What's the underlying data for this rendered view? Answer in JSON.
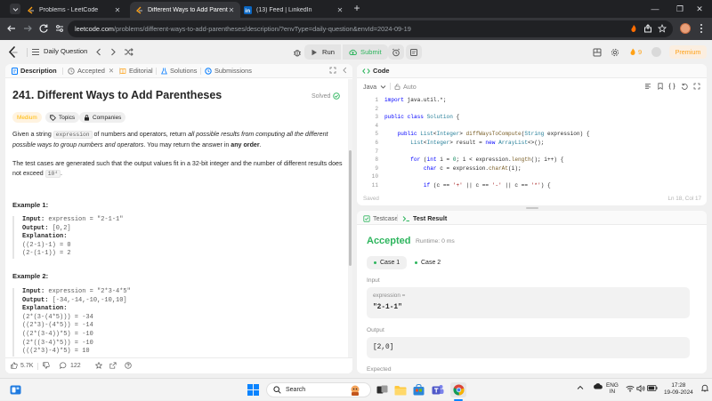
{
  "browser": {
    "tabs": [
      {
        "title": "Problems - LeetCode",
        "icon": "leetcode-icon",
        "active": false
      },
      {
        "title": "Different Ways to Add Parenthe",
        "icon": "leetcode-icon",
        "active": true
      },
      {
        "title": "(13) Feed | LinkedIn",
        "icon": "linkedin-icon",
        "active": false
      }
    ],
    "url_host": "leetcode.com",
    "url_path": "/problems/different-ways-to-add-parentheses/description/?envType=daily-question&envId=2024-09-19"
  },
  "header": {
    "daily_label": "Daily Question",
    "run_label": "Run",
    "submit_label": "Submit",
    "streak_count": "9",
    "premium_label": "Premium",
    "accent": "#ffa116"
  },
  "left": {
    "tabs": [
      "Description",
      "Accepted",
      "Editorial",
      "Solutions",
      "Submissions"
    ],
    "title": "241. Different Ways to Add Parentheses",
    "solved_label": "Solved",
    "chips": [
      "Medium",
      "Topics",
      "Companies"
    ],
    "desc": {
      "p1_a": "Given a string ",
      "p1_code": "expression",
      "p1_b": " of numbers and operators, return ",
      "p1_c": "all possible results from computing all the different possible ways to group numbers and operators",
      "p1_d": ". You may return the answer in ",
      "p1_e": "any order",
      "p1_f": ".",
      "p2_a": "The test cases are generated such that the output values fit in a 32-bit integer and the number of different results does not exceed ",
      "p2_code": "10⁴",
      "p2_b": "."
    },
    "example1": {
      "title": "Example 1:",
      "input_label": "Input:",
      "input_value": "expression = \"2-1-1\"",
      "output_label": "Output:",
      "output_value": "[0,2]",
      "expl_label": "Explanation:",
      "lines": [
        "((2-1)-1) = 0",
        "(2-(1-1)) = 2"
      ]
    },
    "example2": {
      "title": "Example 2:",
      "input_label": "Input:",
      "input_value": "expression = \"2*3-4*5\"",
      "output_label": "Output:",
      "output_value": "[-34,-14,-10,-10,10]",
      "expl_label": "Explanation:",
      "lines": [
        "(2*(3-(4*5))) = -34",
        "((2*3)-(4*5)) = -14",
        "((2*(3-4))*5) = -10",
        "(2*((3-4)*5)) = -10",
        "(((2*3)-4)*5) = 10"
      ]
    },
    "footer": {
      "likes": "5.7K",
      "comments": "122"
    }
  },
  "code": {
    "tab_label": "Code",
    "language": "Java",
    "auto_label": "Auto",
    "lines": [
      "import java.util.*;",
      "",
      "public class Solution {",
      "",
      "    public List<Integer> diffWaysToCompute(String expression) {",
      "        List<Integer> result = new ArrayList<>();",
      "",
      "        for (int i = 0; i < expression.length(); i++) {",
      "            char c = expression.charAt(i);",
      "",
      "            if (c == '+' || c == '-' || c == '*') {"
    ],
    "saved_label": "Saved",
    "cursor_pos": "Ln 18, Col 17"
  },
  "result": {
    "tabs": [
      "Testcase",
      "Test Result"
    ],
    "status": "Accepted",
    "runtime": "Runtime: 0 ms",
    "cases": [
      "Case 1",
      "Case 2"
    ],
    "input_label": "Input",
    "param_name": "expression =",
    "param_value": "\"2-1-1\"",
    "output_label": "Output",
    "output_value": "[2,0]",
    "expected_label": "Expected",
    "accepted_color": "#2db55d"
  },
  "taskbar": {
    "search_placeholder": "Search",
    "lang_line1": "ENG",
    "lang_line2": "IN",
    "time": "17:28",
    "date": "19-09-2024"
  }
}
